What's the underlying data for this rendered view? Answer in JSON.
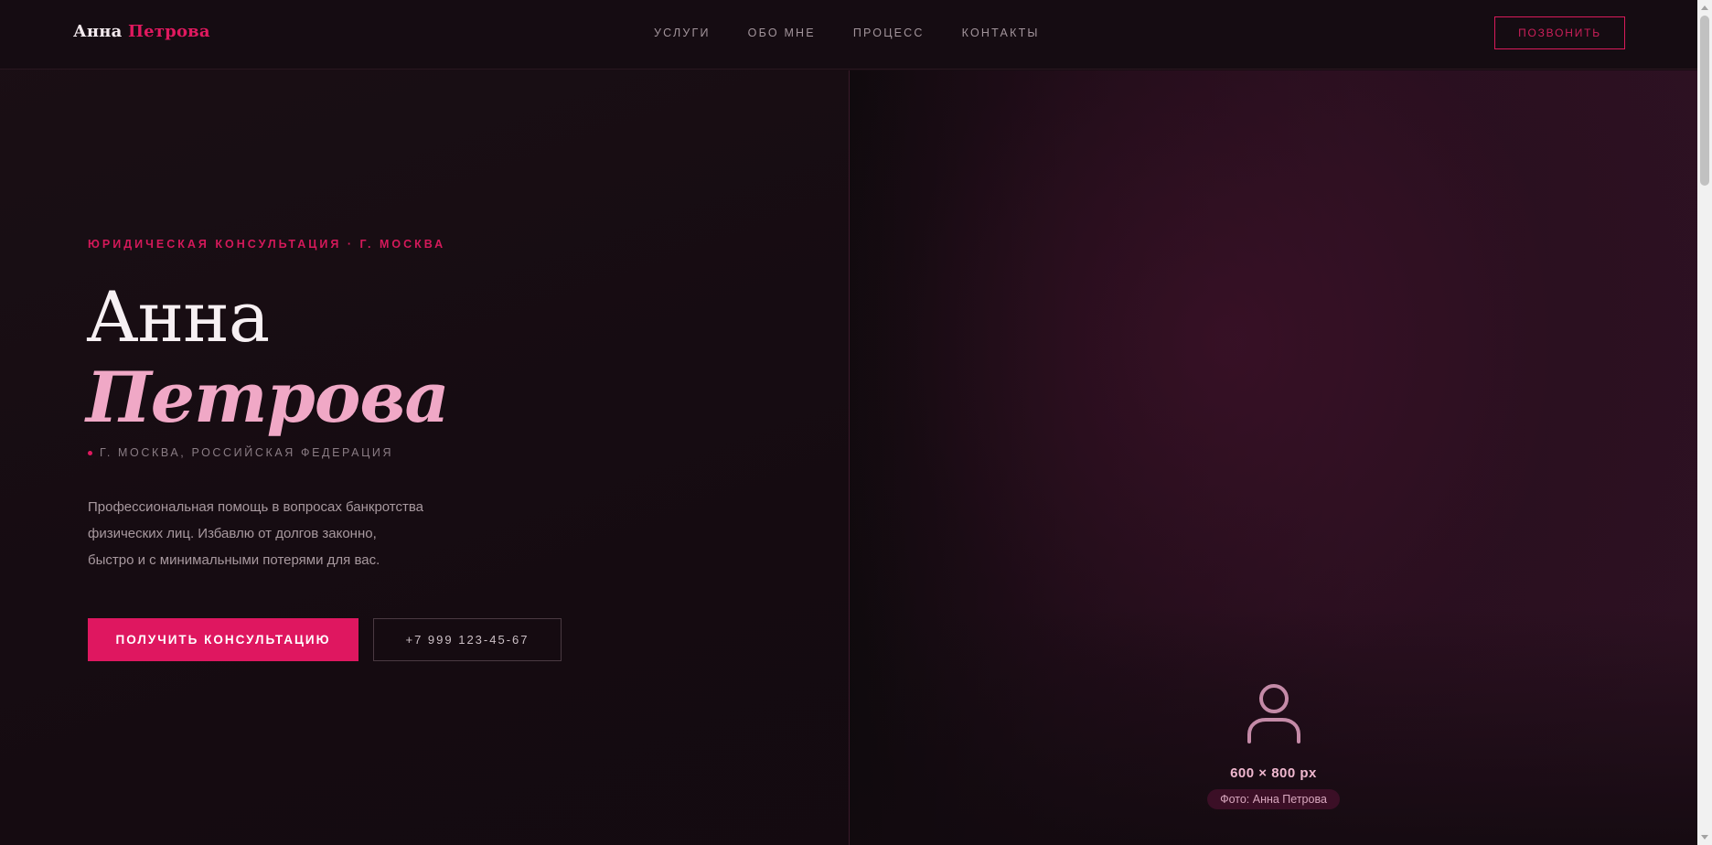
{
  "header": {
    "logo_first": "Анна",
    "logo_last": "Петрова",
    "nav": [
      {
        "label": "УСЛУГИ"
      },
      {
        "label": "ОБО МНЕ"
      },
      {
        "label": "ПРОЦЕСС"
      },
      {
        "label": "КОНТАКТЫ"
      }
    ],
    "call_button": "ПОЗВОНИТЬ"
  },
  "hero": {
    "eyebrow": "ЮРИДИЧЕСКАЯ КОНСУЛЬТАЦИЯ · Г. МОСКВА",
    "name_first": "Анна",
    "name_last": "Петрова",
    "location": "Г. МОСКВА, РОССИЙСКАЯ ФЕДЕРАЦИЯ",
    "description_lines": [
      "Профессиональная помощь в вопросах банкротства",
      "физических лиц. Избавлю от долгов законно,",
      "быстро и с минимальными потерями для вас."
    ],
    "cta_button": "ПОЛУЧИТЬ КОНСУЛЬТАЦИЮ",
    "phone_button": "+7 999 123-45-67"
  },
  "photo": {
    "icon": "person-icon",
    "dimensions": "600 × 800 px",
    "caption": "Фото: Анна Петрова"
  },
  "colors": {
    "accent": "#df1760",
    "accent_soft": "#f0a8c6",
    "background": "#140b11"
  }
}
